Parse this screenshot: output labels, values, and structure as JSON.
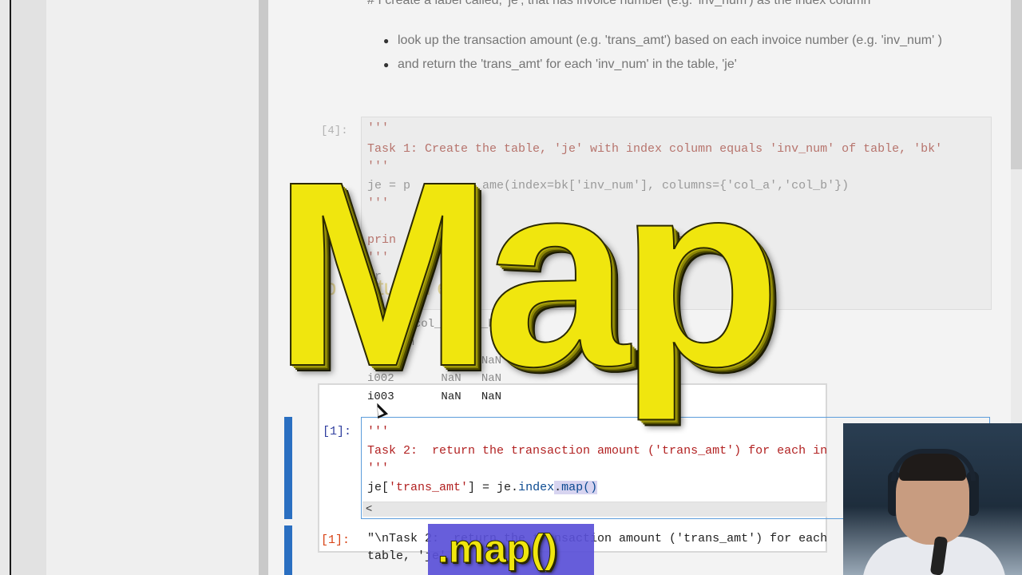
{
  "markdown": {
    "heading": "# I create a label called, 'je', that has invoice number (e.g. 'inv_num') as the index column",
    "bullets": [
      "look up the transaction amount (e.g. 'trans_amt') based on each invoice number (e.g. 'inv_num' )",
      "and return the 'trans_amt' for each 'inv_num' in the table, 'je'"
    ]
  },
  "cell_dim": {
    "prompt": "[4]:",
    "lines": [
      "'''",
      "Task 1: Create the table, 'je' with index column equals 'inv_num' of table, 'bk'",
      "'''",
      "je = p          ame(index=bk['inv_num'], columns={'col_a','col_b'})",
      "'''",
      "",
      "prin      e', t          the               tional)",
      "'''",
      "pr     )"
    ],
    "ghost_link": "tp       w    utu             clu    ec"
  },
  "output_dim": {
    "header": "       col_a  col_b",
    "index_label": "inv_num",
    "rows": [
      "i001       NaN   NaN",
      "i002       NaN   NaN",
      "i003       NaN   NaN"
    ]
  },
  "cell_active": {
    "prompt": "[1]:",
    "line_quote_open": "'''",
    "line_task": "Task 2:  return the transaction amount ('trans_amt') for each in",
    "line_quote_close": "'''",
    "code_var": "je[",
    "code_str": "'trans_amt'",
    "code_mid": "] = je.",
    "code_attr": "index",
    "code_dot": ".",
    "code_map": "map()",
    "scroll_left": "<"
  },
  "output_active": {
    "prompt": "[1]:",
    "line1": "\"\\nTask 2:  return the transaction amount ('trans_amt') for each",
    "line2": "table, 'je'"
  },
  "overlay": {
    "title": "Map",
    "caption": ".map()"
  },
  "colors": {
    "title_yellow": "#f0e60e",
    "caption_bg": "#5a50d8",
    "prompt_in": "#303f9f",
    "prompt_out": "#d84315",
    "focus_blue": "#2a6fc1"
  }
}
